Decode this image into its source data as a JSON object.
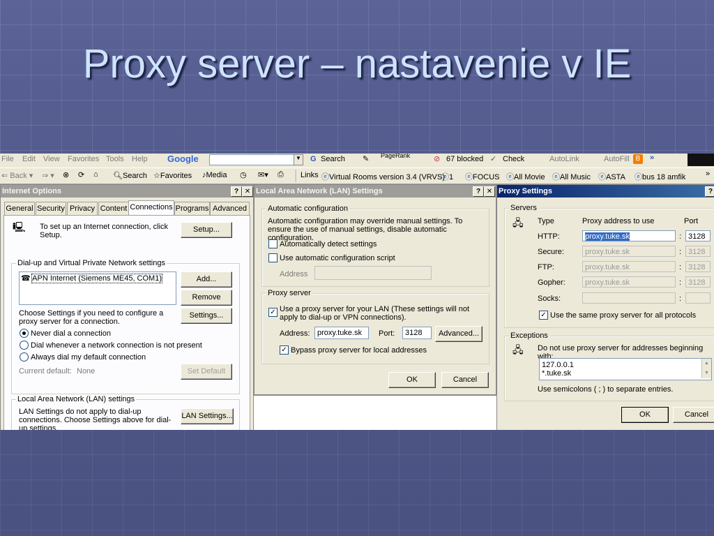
{
  "slide": {
    "title": "Proxy server – nastavenie v IE"
  },
  "menubar": {
    "items": [
      "File",
      "Edit",
      "View",
      "Favorites",
      "Tools",
      "Help"
    ],
    "google_label": "Google",
    "search_label": "Search",
    "pagerank_label": "PageRank",
    "blocked_label": "67 blocked",
    "check_label": "Check",
    "autolink_label": "AutoLink",
    "autofill_label": "AutoFill"
  },
  "toolbar": {
    "back_label": "Back",
    "search_label": "Search",
    "favorites_label": "Favorites",
    "media_label": "Media",
    "links_label": "Links",
    "links": [
      "Virtual Rooms version 3.4 (VRVS)",
      "1",
      "FOCUS",
      "All Movie",
      "All Music",
      "ASTA",
      "bus 18 amfik"
    ]
  },
  "internet_options": {
    "title": "Internet Options",
    "tabs": [
      "General",
      "Security",
      "Privacy",
      "Content",
      "Connections",
      "Programs",
      "Advanced"
    ],
    "setup_text": "To set up an Internet connection, click Setup.",
    "setup_button": "Setup...",
    "dialup_group": "Dial-up and Virtual Private Network settings",
    "connection_item": "APN Internet (Siemens ME45, COM1)",
    "add_button": "Add...",
    "remove_button": "Remove",
    "settings_text": "Choose Settings if you need to configure a proxy server for a connection.",
    "settings_button": "Settings...",
    "radio_never": "Never dial a connection",
    "radio_whenever": "Dial whenever a network connection is not present",
    "radio_always": "Always dial my default connection",
    "current_default_label": "Current default:",
    "current_default_value": "None",
    "set_default_button": "Set Default",
    "lan_group": "Local Area Network (LAN) settings",
    "lan_text": "LAN Settings do not apply to dial-up connections. Choose Settings above for dial-up settings.",
    "lan_button": "LAN Settings..."
  },
  "lan_settings": {
    "title": "Local Area Network (LAN) Settings",
    "auto_group": "Automatic configuration",
    "auto_text": "Automatic configuration may override manual settings.  To ensure the use of manual settings, disable automatic configuration.",
    "auto_detect": "Automatically detect settings",
    "auto_script": "Use automatic configuration script",
    "address_label": "Address",
    "proxy_group": "Proxy server",
    "use_proxy": "Use a proxy server for your LAN (These settings will not apply to dial-up or VPN connections).",
    "proxy_address_label": "Address:",
    "proxy_address_value": "proxy.tuke.sk",
    "port_label": "Port:",
    "port_value": "3128",
    "advanced_button": "Advanced...",
    "bypass": "Bypass proxy server for local addresses",
    "ok_button": "OK",
    "cancel_button": "Cancel"
  },
  "proxy_settings": {
    "title": "Proxy Settings",
    "servers_group": "Servers",
    "col_type": "Type",
    "col_address": "Proxy address to use",
    "col_port": "Port",
    "rows": [
      {
        "type": "HTTP:",
        "address": "proxy.tuke.sk",
        "port": "3128"
      },
      {
        "type": "Secure:",
        "address": "proxy.tuke.sk",
        "port": "3128"
      },
      {
        "type": "FTP:",
        "address": "proxy.tuke.sk",
        "port": "3128"
      },
      {
        "type": "Gopher:",
        "address": "proxy.tuke.sk",
        "port": "3128"
      },
      {
        "type": "Socks:",
        "address": "",
        "port": ""
      }
    ],
    "colon": ":",
    "same_proxy": "Use the same proxy server for all protocols",
    "exceptions_group": "Exceptions",
    "exceptions_text": "Do not use proxy server for addresses beginning with:",
    "exceptions_line1": "127.0.0.1",
    "exceptions_line2": "*.tuke.sk",
    "exceptions_hint": "Use semicolons ( ; ) to separate entries.",
    "ok_button": "OK",
    "cancel_button": "Cancel"
  }
}
